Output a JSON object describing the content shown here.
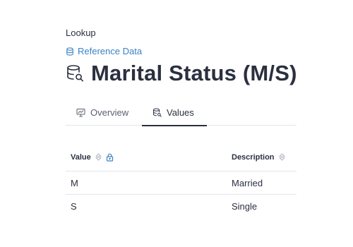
{
  "header": {
    "eyebrow": "Lookup",
    "breadcrumb_link": "Reference Data",
    "title": "Marital Status (M/S)"
  },
  "tabs": [
    {
      "label": "Overview",
      "icon": "presentation-chart-icon",
      "active": false
    },
    {
      "label": "Values",
      "icon": "database-search-icon",
      "active": true
    }
  ],
  "table": {
    "columns": [
      {
        "label": "Value",
        "sortable": true,
        "locked": true
      },
      {
        "label": "Description",
        "sortable": true,
        "locked": false
      }
    ],
    "rows": [
      {
        "value": "M",
        "description": "Married"
      },
      {
        "value": "S",
        "description": "Single"
      }
    ]
  },
  "colors": {
    "link": "#3b82c4",
    "text": "#2b3040",
    "muted": "#5a6070",
    "border": "#e3e5ea",
    "sort_icon": "#b4b8c2"
  }
}
